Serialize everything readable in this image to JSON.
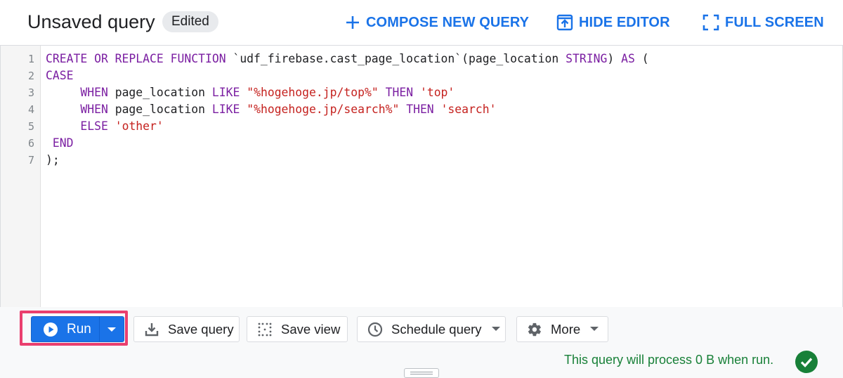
{
  "header": {
    "title": "Unsaved query",
    "badge": "Edited",
    "compose_label": "COMPOSE NEW QUERY",
    "hide_editor_label": "HIDE EDITOR",
    "full_screen_label": "FULL SCREEN",
    "accent_color": "#1a73e8"
  },
  "editor": {
    "lines": [
      {
        "n": "1",
        "tokens": [
          {
            "t": "CREATE OR REPLACE FUNCTION",
            "c": "kw"
          },
          {
            "t": " `udf_firebase.cast_page_location`(page_location ",
            "c": ""
          },
          {
            "t": "STRING",
            "c": "kw"
          },
          {
            "t": ") ",
            "c": ""
          },
          {
            "t": "AS",
            "c": "kw"
          },
          {
            "t": " (",
            "c": ""
          }
        ]
      },
      {
        "n": "2",
        "tokens": [
          {
            "t": "CASE",
            "c": "kw"
          }
        ]
      },
      {
        "n": "3",
        "tokens": [
          {
            "t": "     ",
            "c": ""
          },
          {
            "t": "WHEN",
            "c": "kw"
          },
          {
            "t": " page_location ",
            "c": ""
          },
          {
            "t": "LIKE",
            "c": "kw"
          },
          {
            "t": " ",
            "c": ""
          },
          {
            "t": "\"%hogehoge.jp/top%\"",
            "c": "str"
          },
          {
            "t": " ",
            "c": ""
          },
          {
            "t": "THEN",
            "c": "kw"
          },
          {
            "t": " ",
            "c": ""
          },
          {
            "t": "'top'",
            "c": "str"
          }
        ]
      },
      {
        "n": "4",
        "tokens": [
          {
            "t": "     ",
            "c": ""
          },
          {
            "t": "WHEN",
            "c": "kw"
          },
          {
            "t": " page_location ",
            "c": ""
          },
          {
            "t": "LIKE",
            "c": "kw"
          },
          {
            "t": " ",
            "c": ""
          },
          {
            "t": "\"%hogehoge.jp/search%\"",
            "c": "str"
          },
          {
            "t": " ",
            "c": ""
          },
          {
            "t": "THEN",
            "c": "kw"
          },
          {
            "t": " ",
            "c": ""
          },
          {
            "t": "'search'",
            "c": "str"
          }
        ]
      },
      {
        "n": "5",
        "tokens": [
          {
            "t": "     ",
            "c": ""
          },
          {
            "t": "ELSE",
            "c": "kw"
          },
          {
            "t": " ",
            "c": ""
          },
          {
            "t": "'other'",
            "c": "str"
          }
        ]
      },
      {
        "n": "6",
        "tokens": [
          {
            "t": " ",
            "c": ""
          },
          {
            "t": "END",
            "c": "kw"
          }
        ]
      },
      {
        "n": "7",
        "tokens": [
          {
            "t": ");",
            "c": ""
          }
        ]
      }
    ]
  },
  "toolbar": {
    "run_label": "Run",
    "save_query_label": "Save query",
    "save_view_label": "Save view",
    "schedule_query_label": "Schedule query",
    "more_label": "More",
    "highlight_color": "#ea3f6e"
  },
  "status": {
    "message": "This query will process 0 B when run.",
    "color": "#188038"
  }
}
